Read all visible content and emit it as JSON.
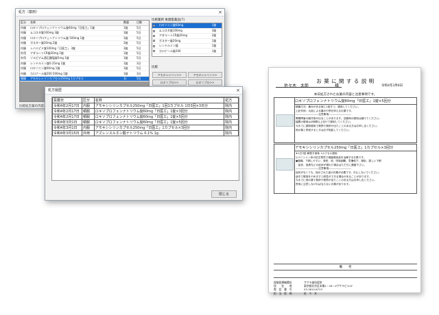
{
  "win1": {
    "title": "処方（薬剤）",
    "headers": [
      "区分",
      "名称",
      "数量",
      "日数"
    ],
    "rows": [
      [
        "内服",
        "ロキソプロフェンナトリウム錠60mg「日医工」1錠",
        "1錠",
        "5日"
      ],
      [
        "内服",
        "ムコスタ錠100mg 3錠",
        "3錠",
        "5日"
      ],
      [
        "内服",
        "ロキソプロフェンナトリウム錠 500mg 1錠",
        "1錠",
        "5日"
      ],
      [
        "内服",
        "ガスター錠20mg 2錠",
        "2錠",
        "5日"
      ],
      [
        "内服",
        "レバミピド錠100mg「日医工」 3錠",
        "3錠",
        "5日"
      ],
      [
        "外用",
        "アダラートCR錠20mg 1錠",
        "1錠",
        "5日"
      ],
      [
        "外用",
        "ゾルピデム酒石酸塩錠5mg 1錠",
        "1錠",
        "5日"
      ],
      [
        "内服",
        "レンドルミン錠0.25mg 1錠",
        "1錠",
        "3日"
      ],
      [
        "内服",
        "ロキソニン錠60mg 1錠",
        "1錠",
        "5日"
      ],
      [
        "内服",
        "カロナール錠200 500mg 1錠",
        "1錠",
        "3日"
      ],
      [
        "頓服",
        "アモキシシリンカプセル250mg 1カプセル",
        "1c",
        "5日"
      ]
    ],
    "sel_row": 10,
    "right_header": "比較薬剤 後発医薬品(T)",
    "right_items": [
      [
        "ロキソニン錠60mg",
        "1錠"
      ],
      [
        "ムコスタ錠100mg",
        "3錠"
      ],
      [
        "アダラートCR錠20mg",
        "2錠"
      ],
      [
        "ガスター錠20mg",
        "1錠"
      ],
      [
        "レンドルミン錠",
        "1錠"
      ],
      [
        "カロナール錠200",
        "1錠"
      ]
    ],
    "right_label": "比較",
    "buttons": [
      "アモキシシリン>>",
      "アモキシシリン>>",
      "ロキソプロ>>",
      "ロキソプロ>>"
    ],
    "status": "比較処方薬の内容表示"
  },
  "win2": {
    "title": "処方履歴",
    "headers": [
      "投薬日",
      "区分",
      "名称",
      "処方"
    ],
    "rows": [
      [
        "令和4年2月17日",
        "内服",
        "アモキシシリンカプセル250mg「日医工」1回1カプセル 1日3回×3日分",
        "院内"
      ],
      [
        "令和4年2月17日",
        "頓服",
        "ロキソプロフェンナトリウム錠60mg「日医工」1錠×3回分",
        "院内"
      ],
      [
        "令和4年2月17日",
        "頓服",
        "ロキソプロフェンナトリウム錠60mg「日医工」1錠×5回分",
        "院内"
      ],
      [
        "令和4年3月1日",
        "頓服",
        "ロキソプロフェンナトリウム錠60mg「日医工」1錠×5回分",
        "院内"
      ],
      [
        "令和4年3月1日",
        "内服",
        "アモキシシリンカプセル250mg「日医工」1カプセル×3回分",
        "院内"
      ],
      [
        "令和4年3月15日",
        "外用",
        "アズレンスルホン酸ナトリウム 0.1% 1g",
        "院内"
      ]
    ],
    "close_label": "閉じる"
  },
  "doc": {
    "title": "お 薬 に 関 す る 説 明",
    "patient": "佐々木　太郎",
    "honorific": "様",
    "date": "令和4年3月8日",
    "intro": "本日処方されたお薬の内容と注意事項です。",
    "drug1": {
      "name": "ロキソプロフェンナトリウム錠60mg「日医工」1錠×5回分",
      "lines": [
        "鎮痛方法：痛みがある時に1錠ずつ、服用してください。",
        "上記作用：炎症による痛みや熱を抑えるお薬です。",
        "―――――――――注意事項―――――――――",
        "胃腸障害の副作用が出ることがあります。空腹時の服用は避けてください。",
        "幅間の服用は4時間以上空けて服用してください。",
        "今までに薬剤服用で発熱や発疹が出たことのある方はお申し出ください。",
        "他の薬と併用するときは必ず相談してください。"
      ]
    },
    "drug2": {
      "name": "アモキシシリンカプセル250mg「日医工」1カプセル×3回分",
      "lines": [
        "★1日3回 朝昼夕食後 1カプセル服用",
        "◎ペニシリン系の抗生物質で細菌感染症を治療するお薬です。",
        "●腹痛、下痢しやすい、発疹、咳、呼吸困難、意識低下、顔色、激しい下痢",
        "　症状、皮膚などの症状が現れた場合はただちに連絡下さい。",
        "―――――――――注意事項―――――――――",
        "症状がなくても、指示された量の内服が必要です。中止しないでください。",
        "途中で服用をやめますと耐性ができる場合があることがあります。",
        "今までに他の薬で発疹や発熱が出たことのある方はお申し出ください。",
        "併用に注意しなければならないお薬があります。"
      ]
    },
    "remarks_label": "備　　考",
    "footer": [
      [
        "保険医療機関名",
        "ササキ歯科医院"
      ],
      [
        "所　　在　　地",
        "東京都文京区本郷1－26－4ササキビル1F"
      ],
      [
        "電　話　番　号",
        "03-3810-8723"
      ],
      [
        "担　当　医　師",
        "佐　々　木"
      ]
    ]
  }
}
